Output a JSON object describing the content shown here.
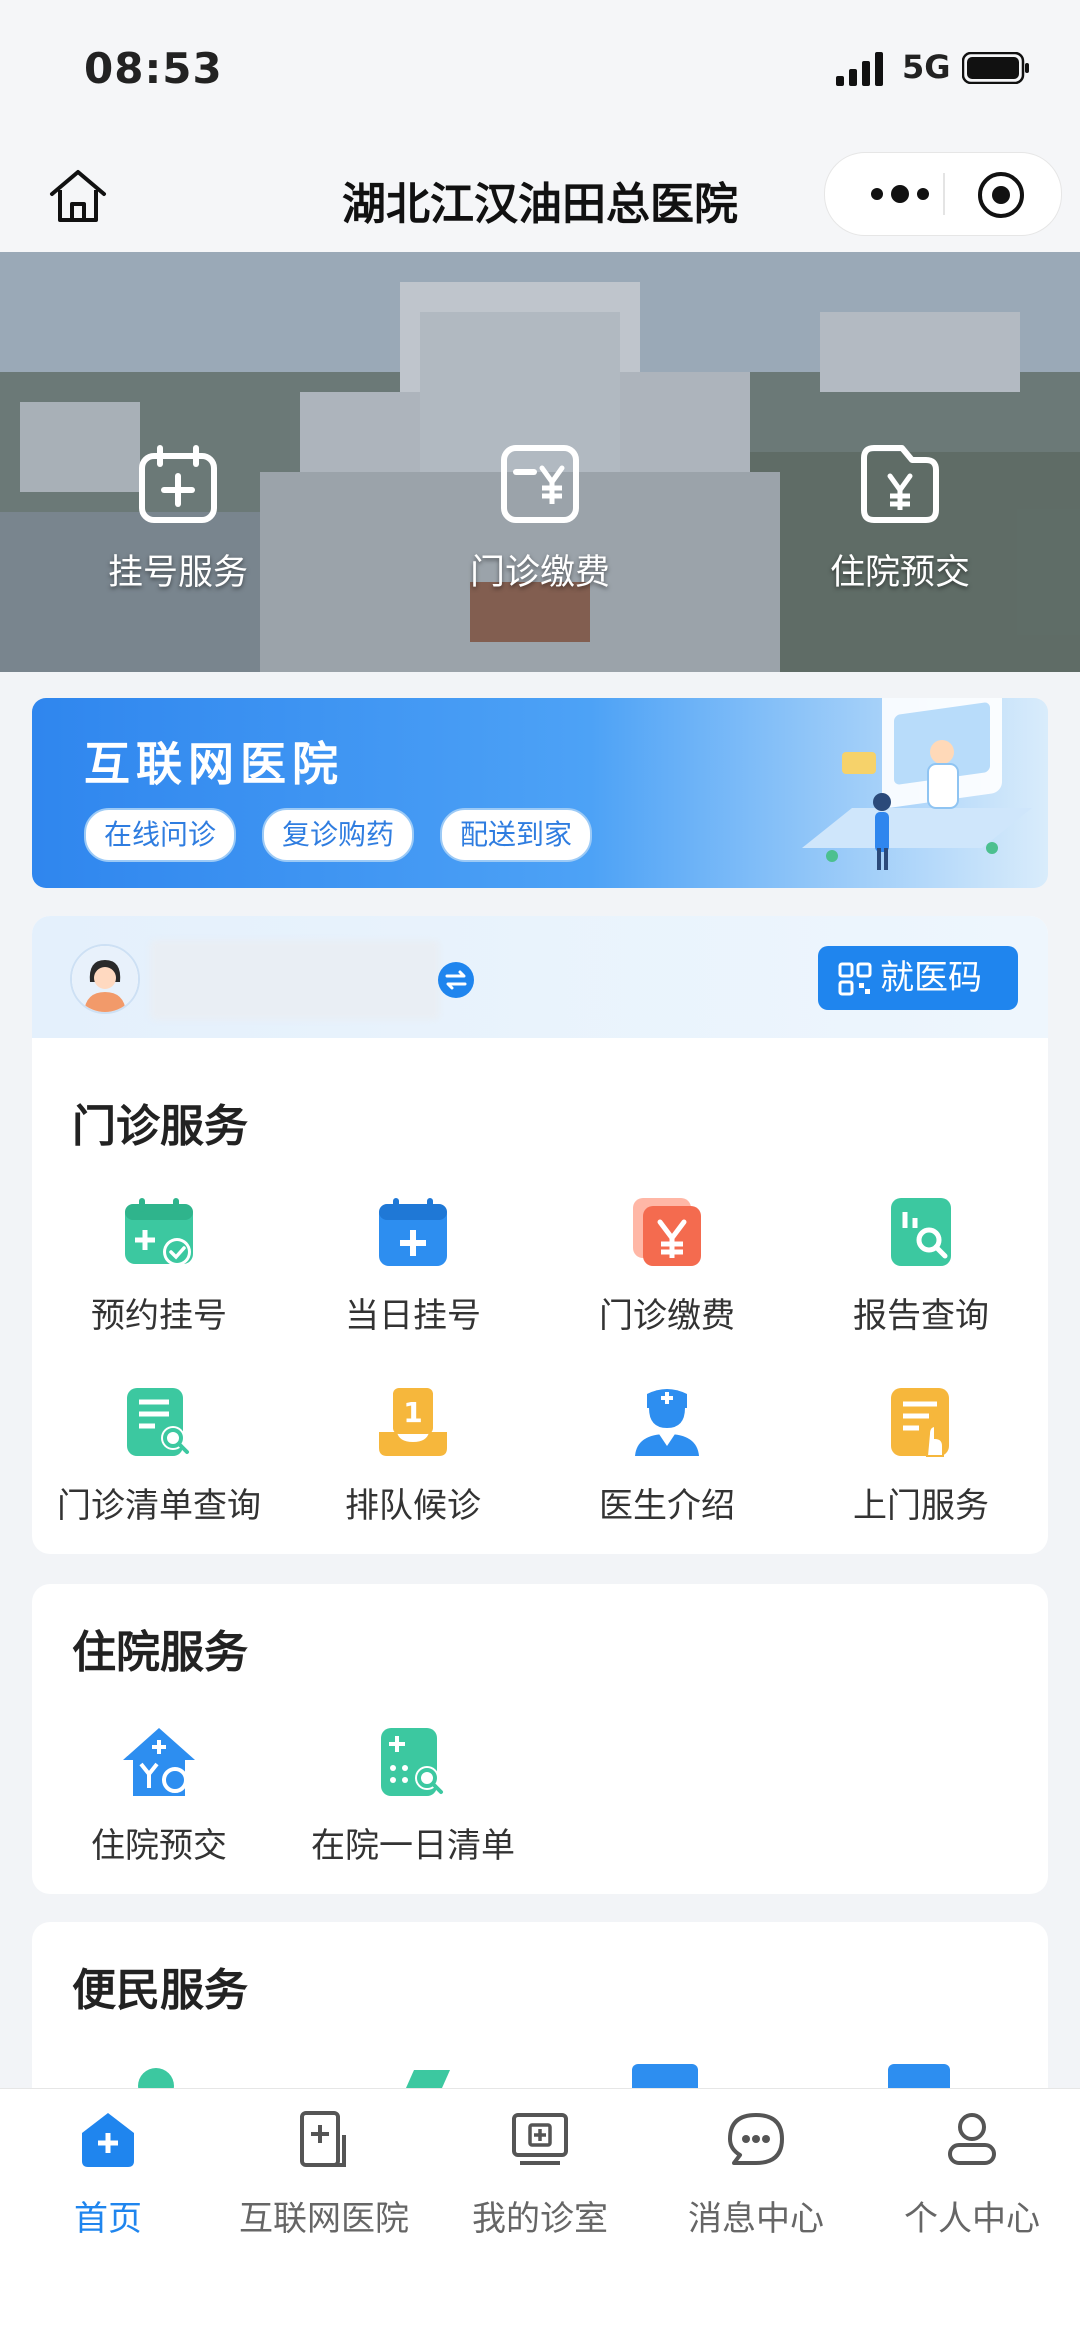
{
  "status_bar": {
    "time": "08:53",
    "network": "5G"
  },
  "nav": {
    "title": "湖北江汉油田总医院"
  },
  "hero": {
    "items": [
      {
        "label": "挂号服务",
        "icon": "calendar-plus-icon"
      },
      {
        "label": "门诊缴费",
        "icon": "bill-yen-icon"
      },
      {
        "label": "住院预交",
        "icon": "folder-yen-icon"
      }
    ]
  },
  "banner": {
    "title": "互联网医院",
    "chips": [
      "在线问诊",
      "复诊购药",
      "配送到家"
    ]
  },
  "user_bar": {
    "code_button": "就医码"
  },
  "outpatient": {
    "title": "门诊服务",
    "items": [
      {
        "label": "预约挂号",
        "icon": "calendar-check-icon"
      },
      {
        "label": "当日挂号",
        "icon": "calendar-add-icon"
      },
      {
        "label": "门诊缴费",
        "icon": "yen-bill-icon"
      },
      {
        "label": "报告查询",
        "icon": "report-search-icon"
      },
      {
        "label": "门诊清单查询",
        "icon": "list-search-icon"
      },
      {
        "label": "排队候诊",
        "icon": "queue-number-icon"
      },
      {
        "label": "医生介绍",
        "icon": "doctor-icon"
      },
      {
        "label": "上门服务",
        "icon": "home-visit-doc-icon"
      }
    ]
  },
  "inpatient": {
    "title": "住院服务",
    "items": [
      {
        "label": "住院预交",
        "icon": "house-yen-icon"
      },
      {
        "label": "在院一日清单",
        "icon": "daily-list-icon"
      }
    ]
  },
  "convenience": {
    "title": "便民服务"
  },
  "tabbar": {
    "items": [
      {
        "label": "首页",
        "icon": "home-plus-icon"
      },
      {
        "label": "互联网医院",
        "icon": "internet-hospital-icon"
      },
      {
        "label": "我的诊室",
        "icon": "clinic-icon"
      },
      {
        "label": "消息中心",
        "icon": "message-icon"
      },
      {
        "label": "个人中心",
        "icon": "profile-icon"
      }
    ]
  },
  "colors": {
    "accent": "#1f85ee",
    "green": "#3cc8a0",
    "orange": "#f46b4f",
    "yellow": "#f6b73c"
  }
}
